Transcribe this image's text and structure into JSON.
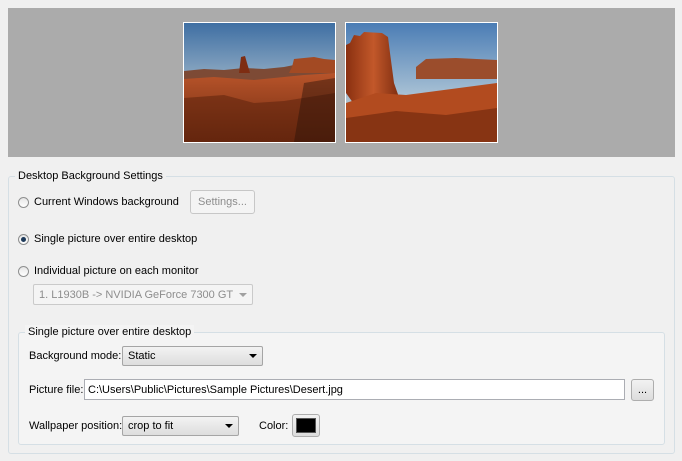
{
  "preview": {
    "monitors": [
      {
        "name": "monitor-1",
        "image": "desert-landscape"
      },
      {
        "name": "monitor-2",
        "image": "desert-butte"
      }
    ]
  },
  "settings_group": {
    "title": "Desktop Background Settings",
    "options": {
      "current": {
        "label": "Current Windows background",
        "checked": false
      },
      "single": {
        "label": "Single picture over entire desktop",
        "checked": true
      },
      "individual": {
        "label": "Individual picture on each monitor",
        "checked": false
      }
    },
    "settings_button": "Settings...",
    "monitor_select": "1. L1930B -> NVIDIA GeForce 7300 GT"
  },
  "single_group": {
    "title": "Single picture over entire desktop",
    "background_mode_label": "Background mode:",
    "background_mode_value": "Static",
    "picture_file_label": "Picture file:",
    "picture_file_value": "C:\\Users\\Public\\Pictures\\Sample Pictures\\Desert.jpg",
    "browse_button": "...",
    "wallpaper_position_label": "Wallpaper position:",
    "wallpaper_position_value": "crop to fit",
    "color_label": "Color:",
    "color_value": "#000000"
  }
}
